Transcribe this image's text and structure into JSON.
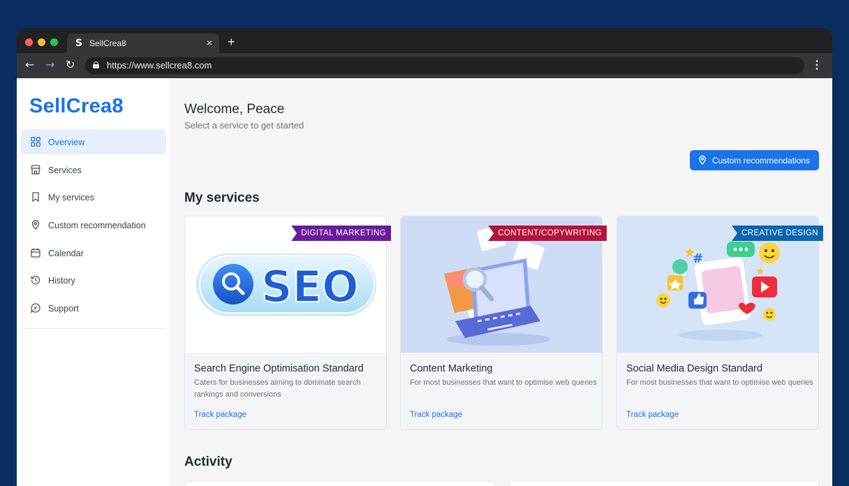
{
  "browser": {
    "tab": {
      "title": "SellCrea8",
      "favicon": "S",
      "close": "×"
    },
    "new_tab": "+",
    "url": "https://www.sellcrea8.com",
    "icons": {
      "back": "←",
      "forward": "→",
      "reload": "↻",
      "menu": "⋮"
    }
  },
  "sidebar": {
    "logo": "SellCrea8",
    "items": [
      {
        "label": "Overview",
        "icon": "grid-icon",
        "active": true
      },
      {
        "label": "Services",
        "icon": "storefront-icon"
      },
      {
        "label": "My services",
        "icon": "bookmark-icon"
      },
      {
        "label": "Custom recommendation",
        "icon": "location-pin-icon"
      },
      {
        "label": "Calendar",
        "icon": "calendar-icon"
      },
      {
        "label": "History",
        "icon": "history-icon"
      },
      {
        "label": "Support",
        "icon": "chat-icon"
      }
    ]
  },
  "main": {
    "welcome": "Welcome, Peace",
    "subtitle": "Select a service to get started",
    "recommend_button": "Custom recommendations",
    "my_services_title": "My services",
    "activity_title": "Activity",
    "cards": [
      {
        "tag": "DIGITAL MARKETING",
        "tag_color": "#6a1b9a",
        "image_text": "SEO",
        "title": "Search Engine Optimisation Standard",
        "description": "Caters for businesses aiming to dominate search rankings and conversions",
        "link": "Track package"
      },
      {
        "tag": "CONTENT/COPYWRITING",
        "tag_color": "#b3123a",
        "title": "Content Marketing",
        "description": "For most businesses that want to optimise web queries",
        "link": "Track package"
      },
      {
        "tag": "CREATIVE DESIGN",
        "tag_color": "#0b64b0",
        "title": "Social Media Design Standard",
        "description": "For most businesses that want to optimise web queries",
        "link": "Track package"
      }
    ]
  },
  "colors": {
    "accent": "#1a73e8",
    "background": "#0b2c5f"
  }
}
